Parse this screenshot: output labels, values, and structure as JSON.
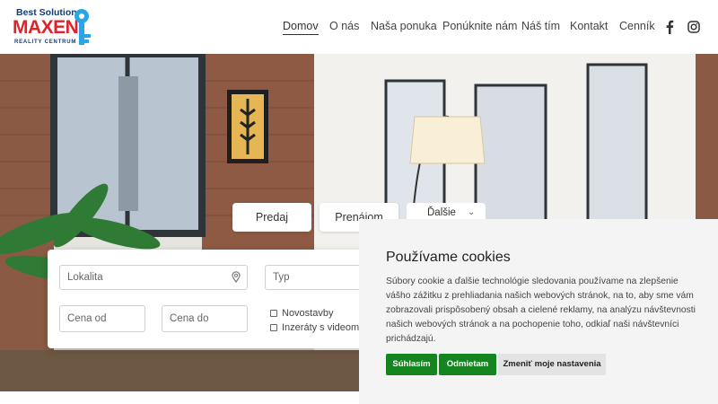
{
  "logo": {
    "line1": "Best Solution",
    "line2": "MAXEN",
    "line3": "REALITY CENTRUM"
  },
  "nav": {
    "items": [
      {
        "label": "Domov",
        "active": true
      },
      {
        "label": "O nás",
        "active": false
      },
      {
        "label": "Naša ponuka",
        "active": false
      },
      {
        "label": "Ponúknite nám",
        "active": false
      },
      {
        "label": "Náš tím",
        "active": false
      },
      {
        "label": "Kontakt",
        "active": false
      },
      {
        "label": "Cenník",
        "active": false
      }
    ],
    "social": [
      "facebook-icon",
      "instagram-icon"
    ]
  },
  "tabs": {
    "sale": "Predaj",
    "rent": "Prenájom",
    "more": "Ďalšie"
  },
  "search": {
    "location_placeholder": "Lokalita",
    "type_placeholder": "Typ",
    "price_from_placeholder": "Cena od",
    "price_to_placeholder": "Cena do",
    "new_builds_label": "Novostavby",
    "video_label": "Inzeráty s videom"
  },
  "cookie": {
    "title": "Používame cookies",
    "text": "Súbory cookie a ďalšie technológie sledovania používame na zlepšenie vášho zážitku z prehliadania našich webových stránok, na to, aby sme vám zobrazovali prispôsobený obsah a cielené reklamy, na analýzu návštevnosti našich webových stránok a na pochopenie toho, odkiaľ naši návštevníci prichádzajú.",
    "accept": "Súhlasím",
    "reject": "Odmietam",
    "settings": "Zmeniť moje nastavenia"
  },
  "colors": {
    "brand_blue": "#123c78",
    "brand_red": "#e0222a",
    "accept_green": "#15851f"
  }
}
